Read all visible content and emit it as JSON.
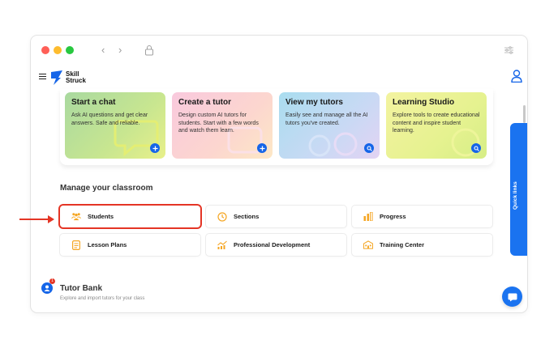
{
  "app": {
    "logo_line1": "Skill",
    "logo_line2": "Struck",
    "brand_color": "#1565e8"
  },
  "cards": [
    {
      "title": "Start a chat",
      "description": "Ask AI questions and get clear answers. Safe and reliable.",
      "button_icon": "plus-icon"
    },
    {
      "title": "Create a tutor",
      "description": "Design custom AI tutors for students. Start with a few words and watch them learn.",
      "button_icon": "plus-icon"
    },
    {
      "title": "View my tutors",
      "description": "Easily see and manage all the AI tutors you've created.",
      "button_icon": "search-icon"
    },
    {
      "title": "Learning Studio",
      "description": "Explore tools to create educational content and inspire student learning.",
      "button_icon": "search-icon"
    }
  ],
  "classroom": {
    "title": "Manage your classroom",
    "tiles": [
      {
        "label": "Students",
        "icon": "students-icon"
      },
      {
        "label": "Sections",
        "icon": "clock-icon"
      },
      {
        "label": "Progress",
        "icon": "bar-chart-icon"
      },
      {
        "label": "Lesson Plans",
        "icon": "document-icon"
      },
      {
        "label": "Professional Development",
        "icon": "growth-chart-icon"
      },
      {
        "label": "Training Center",
        "icon": "building-icon"
      }
    ]
  },
  "quick_links": {
    "label": "Quick links"
  },
  "tutor_bank": {
    "title": "Tutor Bank",
    "description": "Explore and import tutors for your class",
    "badge": "1"
  },
  "colors": {
    "highlight": "#e43525",
    "accent": "#1a73f0"
  }
}
